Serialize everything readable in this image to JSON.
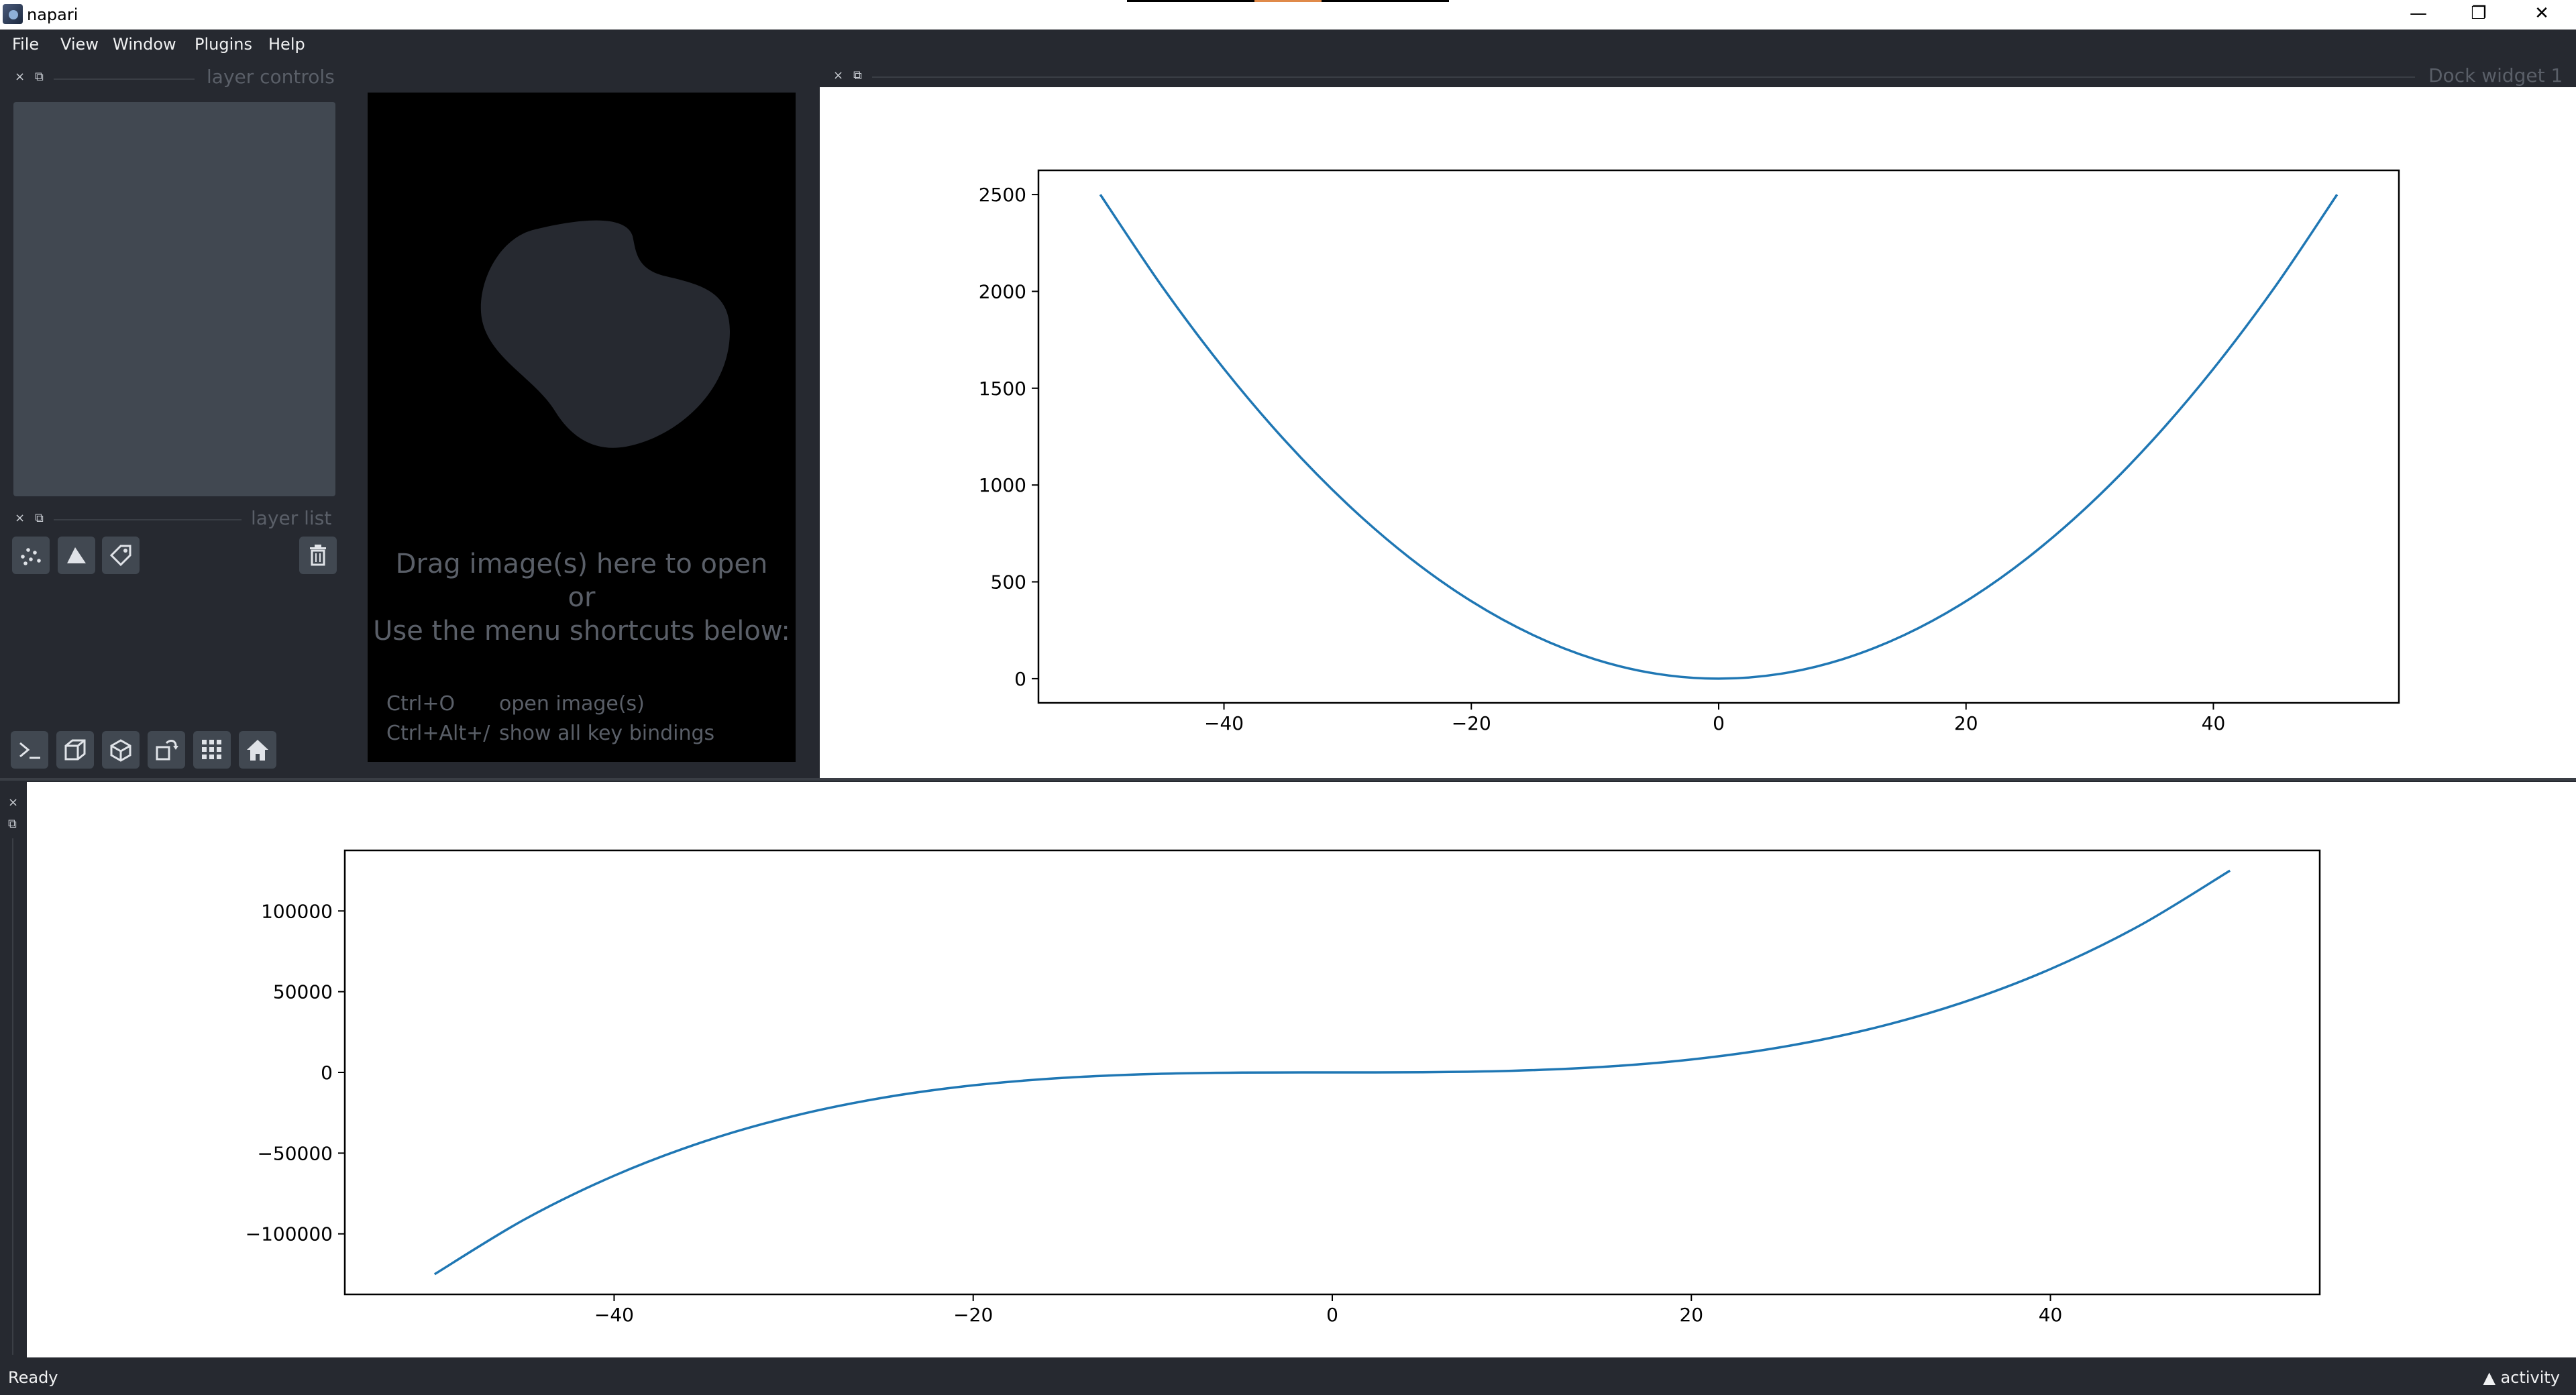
{
  "app": {
    "title": "napari"
  },
  "window_controls": {
    "minimize": "—",
    "restore": "❐",
    "close": "✕"
  },
  "menu": [
    "File",
    "View",
    "Window",
    "Plugins",
    "Help"
  ],
  "docks": {
    "layer_controls": {
      "title": "layer controls"
    },
    "layer_list": {
      "title": "layer list"
    },
    "plot_top": {
      "title": "Dock widget 1"
    },
    "close_glyph": "×",
    "float_glyph": "⧉"
  },
  "layer_buttons": [
    "points-icon",
    "shapes-icon",
    "labels-icon",
    "delete-icon"
  ],
  "viewer_buttons": [
    "console-icon",
    "ndisplay-icon",
    "roll-icon",
    "transpose-icon",
    "grid-icon",
    "home-icon"
  ],
  "welcome": {
    "line1": "Drag image(s) here to open",
    "line2": "or",
    "line3": "Use the menu shortcuts below:",
    "shortcuts": [
      {
        "key": "Ctrl+O",
        "desc": "open image(s)"
      },
      {
        "key": "Ctrl+Alt+/",
        "desc": "show all key bindings"
      }
    ]
  },
  "colors": {
    "line": "#1f77b4",
    "canvas": "#000000",
    "panel": "#262930",
    "control": "#414851"
  },
  "chart_data": [
    {
      "type": "line",
      "title": "",
      "xlabel": "",
      "ylabel": "",
      "x": [
        -50,
        -45,
        -40,
        -35,
        -30,
        -25,
        -20,
        -15,
        -10,
        -5,
        0,
        5,
        10,
        15,
        20,
        25,
        30,
        35,
        40,
        45,
        50
      ],
      "y": [
        2500,
        2025,
        1600,
        1225,
        900,
        625,
        400,
        225,
        100,
        25,
        0,
        25,
        100,
        225,
        400,
        625,
        900,
        1225,
        1600,
        2025,
        2500
      ],
      "xlim": [
        -55,
        55
      ],
      "ylim": [
        -125,
        2625
      ],
      "xticks": [
        "−40",
        "−20",
        "0",
        "20",
        "40"
      ],
      "yticks": [
        "0",
        "500",
        "1000",
        "1500",
        "2000",
        "2500"
      ],
      "grid": false
    },
    {
      "type": "line",
      "title": "",
      "xlabel": "",
      "ylabel": "",
      "x": [
        -50,
        -45,
        -40,
        -35,
        -30,
        -25,
        -20,
        -15,
        -10,
        -5,
        0,
        5,
        10,
        15,
        20,
        25,
        30,
        35,
        40,
        45,
        50
      ],
      "y": [
        -125000,
        -91125,
        -64000,
        -42875,
        -27000,
        -15625,
        -8000,
        -3375,
        -1000,
        -125,
        0,
        125,
        1000,
        3375,
        8000,
        15625,
        27000,
        42875,
        64000,
        91125,
        125000
      ],
      "xlim": [
        -55,
        55
      ],
      "ylim": [
        -137500,
        137500
      ],
      "xticks": [
        "−40",
        "−20",
        "0",
        "20",
        "40"
      ],
      "yticks": [
        "−100000",
        "−50000",
        "0",
        "50000",
        "100000"
      ],
      "grid": false
    }
  ],
  "status": {
    "text": "Ready",
    "activity": "▲ activity"
  }
}
